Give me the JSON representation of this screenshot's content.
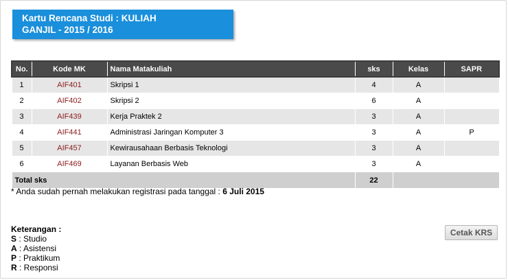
{
  "header": {
    "title_line1": "Kartu Rencana Studi : KULIAH",
    "title_line2": "GANJIL - 2015 / 2016"
  },
  "table": {
    "columns": [
      "No.",
      "Kode MK",
      "Nama Matakuliah",
      "sks",
      "Kelas",
      "SAPR"
    ],
    "rows": [
      {
        "no": "1",
        "kode": "AIF401",
        "nama": "Skripsi 1",
        "sks": "4",
        "kelas": "A",
        "sapr": ""
      },
      {
        "no": "2",
        "kode": "AIF402",
        "nama": "Skripsi 2",
        "sks": "6",
        "kelas": "A",
        "sapr": ""
      },
      {
        "no": "3",
        "kode": "AIF439",
        "nama": "Kerja Praktek 2",
        "sks": "3",
        "kelas": "A",
        "sapr": ""
      },
      {
        "no": "4",
        "kode": "AIF441",
        "nama": "Administrasi Jaringan Komputer 3",
        "sks": "3",
        "kelas": "A",
        "sapr": "P"
      },
      {
        "no": "5",
        "kode": "AIF457",
        "nama": "Kewirausahaan Berbasis Teknologi",
        "sks": "3",
        "kelas": "A",
        "sapr": ""
      },
      {
        "no": "6",
        "kode": "AIF469",
        "nama": "Layanan Berbasis Web",
        "sks": "3",
        "kelas": "A",
        "sapr": ""
      }
    ],
    "total_label": "Total sks",
    "total_value": "22"
  },
  "note": {
    "text": "* Anda sudah pernah melakukan registrasi pada tanggal : ",
    "date": "6 Juli 2015"
  },
  "legend": {
    "title": "Keterangan :",
    "items": [
      {
        "key": "S",
        "desc": " : Studio"
      },
      {
        "key": "A",
        "desc": " : Asistensi"
      },
      {
        "key": "P",
        "desc": " : Praktikum"
      },
      {
        "key": "R",
        "desc": " : Responsi"
      }
    ]
  },
  "actions": {
    "print_label": "Cetak KRS"
  }
}
